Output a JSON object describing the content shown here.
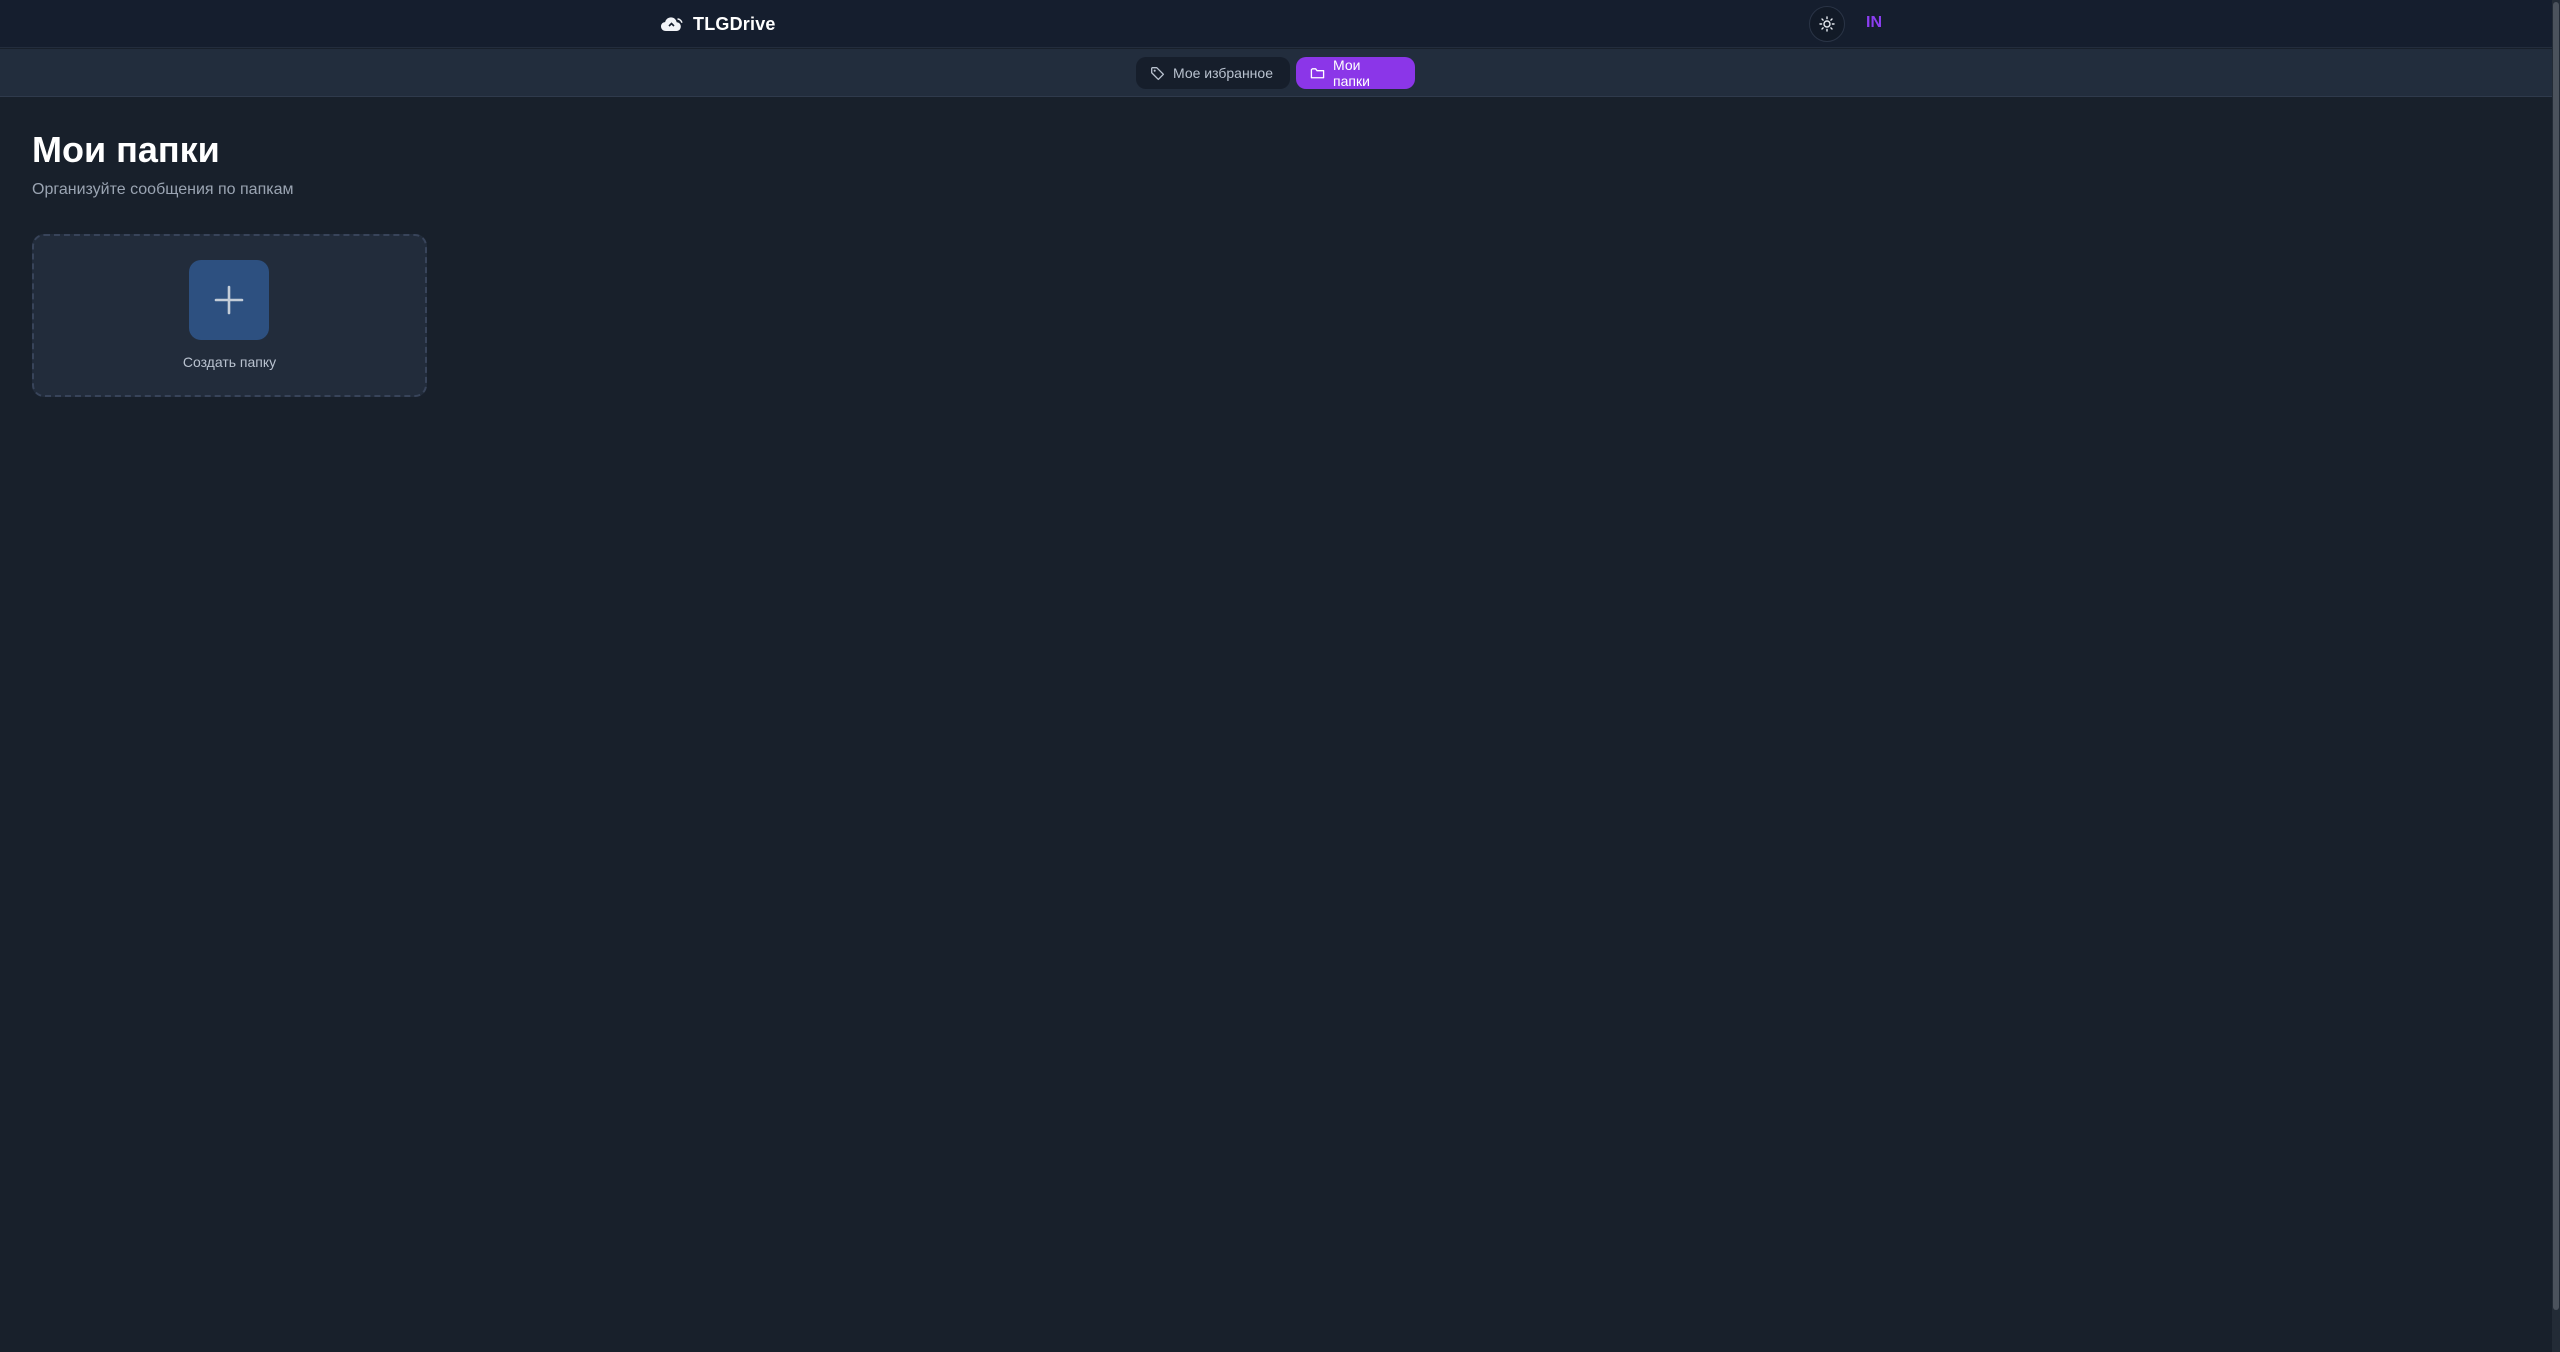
{
  "app": {
    "name": "TLGDrive",
    "logo_icon": "cloud-logo-icon",
    "language": "IN",
    "theme_toggle_icon": "sun-icon"
  },
  "nav": {
    "tabs": [
      {
        "label": "Мое избранное",
        "icon": "tag-icon",
        "active": false
      },
      {
        "label": "Мои папки",
        "icon": "folder-icon",
        "active": true
      }
    ]
  },
  "page": {
    "title": "Мои папки",
    "subtitle": "Организуйте сообщения по папкам"
  },
  "create_folder": {
    "label": "Создать папку",
    "icon": "plus-icon"
  },
  "colors": {
    "accent": "#8b36e8",
    "background": "#18202b",
    "header": "#151e2e",
    "navbar": "#222d3d",
    "card": "#222c3b",
    "plus_tile": "#2d5080"
  }
}
